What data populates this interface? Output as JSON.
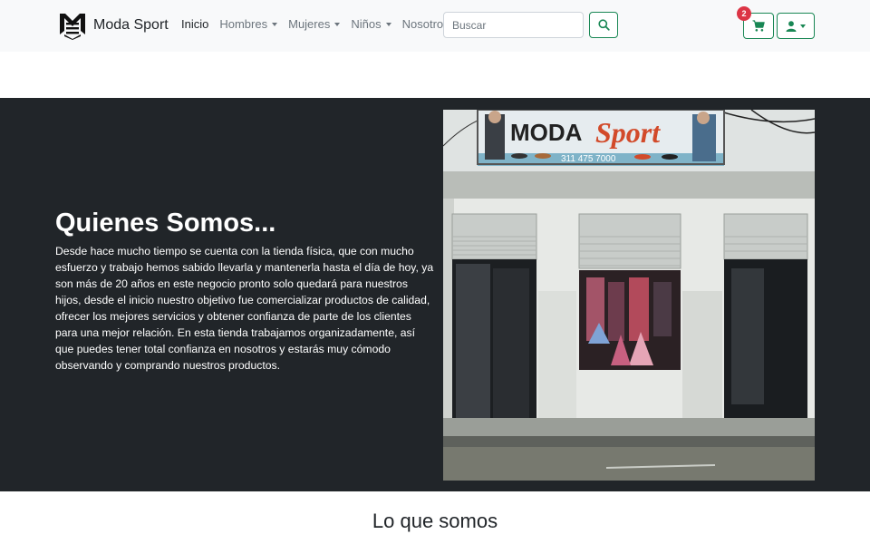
{
  "brand": {
    "name": "Moda Sport",
    "logo_icon": "ms-logo-icon"
  },
  "nav": {
    "items": [
      {
        "label": "Inicio",
        "active": true,
        "dropdown": false
      },
      {
        "label": "Hombres",
        "active": false,
        "dropdown": true
      },
      {
        "label": "Mujeres",
        "active": false,
        "dropdown": true
      },
      {
        "label": "Niños",
        "active": false,
        "dropdown": true
      },
      {
        "label": "Nosotros",
        "active": false,
        "dropdown": false
      }
    ]
  },
  "search": {
    "placeholder": "Buscar",
    "value": "",
    "icon": "search-icon"
  },
  "cart": {
    "count": "2",
    "icon": "cart-icon"
  },
  "user": {
    "icon": "user-icon"
  },
  "hero": {
    "title": "Quienes Somos...",
    "body": "Desde hace mucho tiempo se cuenta con la tienda física, que con mucho esfuerzo y trabajo hemos sabido llevarla y mantenerla hasta el día de hoy, ya son más de 20 años en este negocio pronto solo quedará para nuestros hijos, desde el inicio nuestro objetivo fue comercializar productos de calidad, ofrecer los mejores servicios y obtener confianza de parte de los clientes para una mejor relación. En esta tienda trabajamos organizadamente, así que puedes tener total confianza en nosotros y estarás muy cómodo observando y comprando nuestros productos.",
    "sign_text": "MODA",
    "sign_script": "Sport",
    "sign_phone": "311 475 7000"
  },
  "section": {
    "title": "Lo que somos"
  },
  "colors": {
    "accent": "#198754",
    "badge": "#dc3545",
    "navbar_bg": "#f8f9fa",
    "hero_bg": "#212529"
  }
}
